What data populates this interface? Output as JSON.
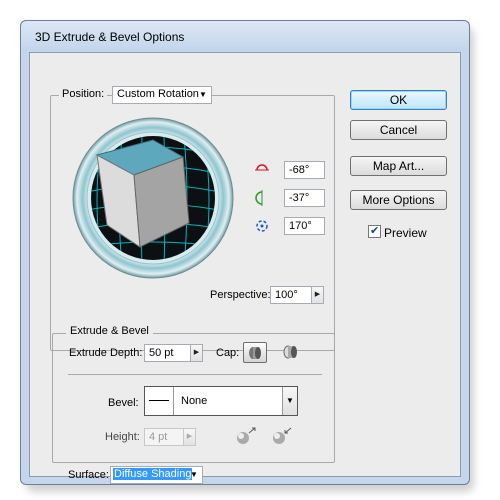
{
  "window": {
    "title": "3D Extrude & Bevel Options"
  },
  "position": {
    "label": "Position:",
    "value": "Custom Rotation"
  },
  "rotation": {
    "x": "-68°",
    "y": "-37°",
    "z": "170°"
  },
  "perspective": {
    "label": "Perspective:",
    "value": "100°"
  },
  "extrude_bevel": {
    "legend": "Extrude & Bevel",
    "depth_label": "Extrude Depth:",
    "depth_value": "50 pt",
    "cap_label": "Cap:",
    "bevel_label": "Bevel:",
    "bevel_value": "None",
    "height_label": "Height:",
    "height_value": "4 pt"
  },
  "surface": {
    "label": "Surface:",
    "value": "Diffuse Shading"
  },
  "buttons": {
    "ok": "OK",
    "cancel": "Cancel",
    "map_art": "Map Art...",
    "more_options": "More Options"
  },
  "preview": {
    "label": "Preview",
    "checked": true
  },
  "icons": {
    "close": "close-icon",
    "x_axis": "x-rotation-icon",
    "y_axis": "y-rotation-icon",
    "z_axis": "z-rotation-icon",
    "cap_on": "cap-on-icon",
    "cap_off": "cap-off-icon",
    "bevel_out": "bevel-extent-out-icon",
    "bevel_in": "bevel-extent-in-icon"
  },
  "colors": {
    "accent": "#3399ff",
    "cube_top": "#5ea8bd",
    "grid": "#00c0c8"
  }
}
